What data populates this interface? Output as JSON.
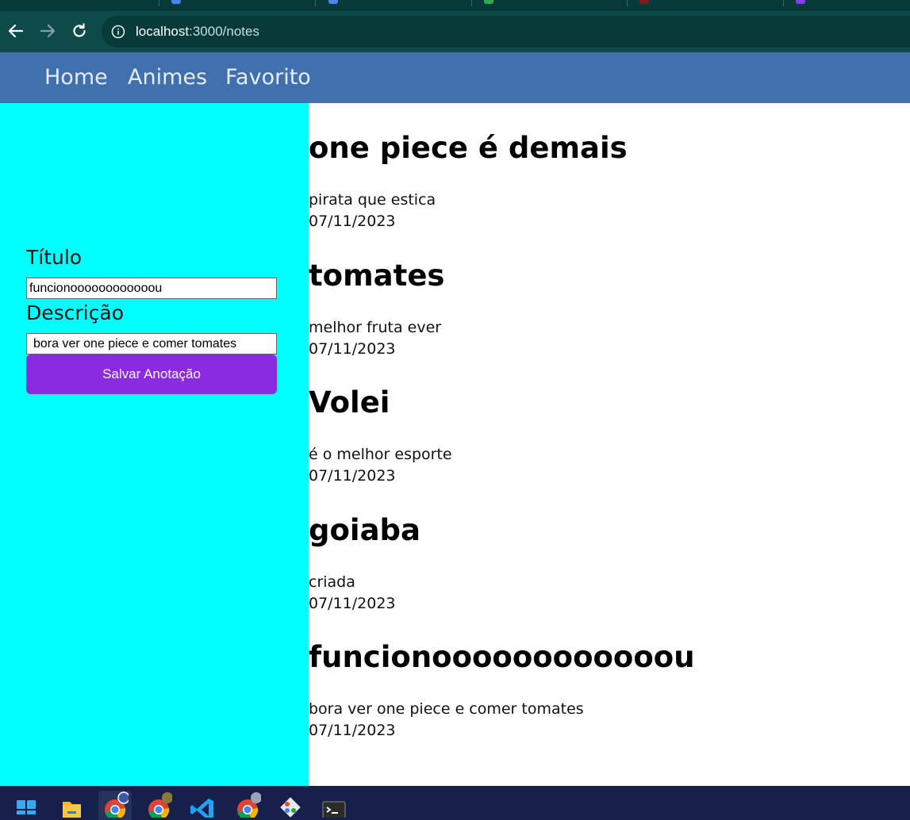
{
  "browser": {
    "url_host": "localhost",
    "url_path": ":3000/notes"
  },
  "navbar": {
    "links": [
      "Home",
      "Animes",
      "Favorito"
    ]
  },
  "form": {
    "title_label": "Título",
    "title_value": "funcionoooooooooooou",
    "description_label": "Descrição",
    "description_value": "bora ver one piece e comer tomates",
    "save_label": "Salvar Anotação"
  },
  "notes": [
    {
      "title": "one piece é demais",
      "description": "pirata que estica",
      "date": "07/11/2023"
    },
    {
      "title": "tomates",
      "description": "melhor fruta ever",
      "date": "07/11/2023"
    },
    {
      "title": "Volei",
      "description": "é o melhor esporte",
      "date": "07/11/2023"
    },
    {
      "title": "goiaba",
      "description": "criada",
      "date": "07/11/2023"
    },
    {
      "title": "funcionoooooooooooou",
      "description": "bora ver one piece e comer tomates",
      "date": "07/11/2023"
    }
  ],
  "colors": {
    "navbar": "#4170ae",
    "sidebar": "#00ffff",
    "save_button": "#8a2be2"
  },
  "taskbar": {
    "icons": [
      "windows-start-icon",
      "file-explorer-icon",
      "chrome-icon",
      "chrome-profile-icon",
      "vscode-icon",
      "chrome-profile-icon",
      "git-icon",
      "terminal-icon"
    ]
  }
}
